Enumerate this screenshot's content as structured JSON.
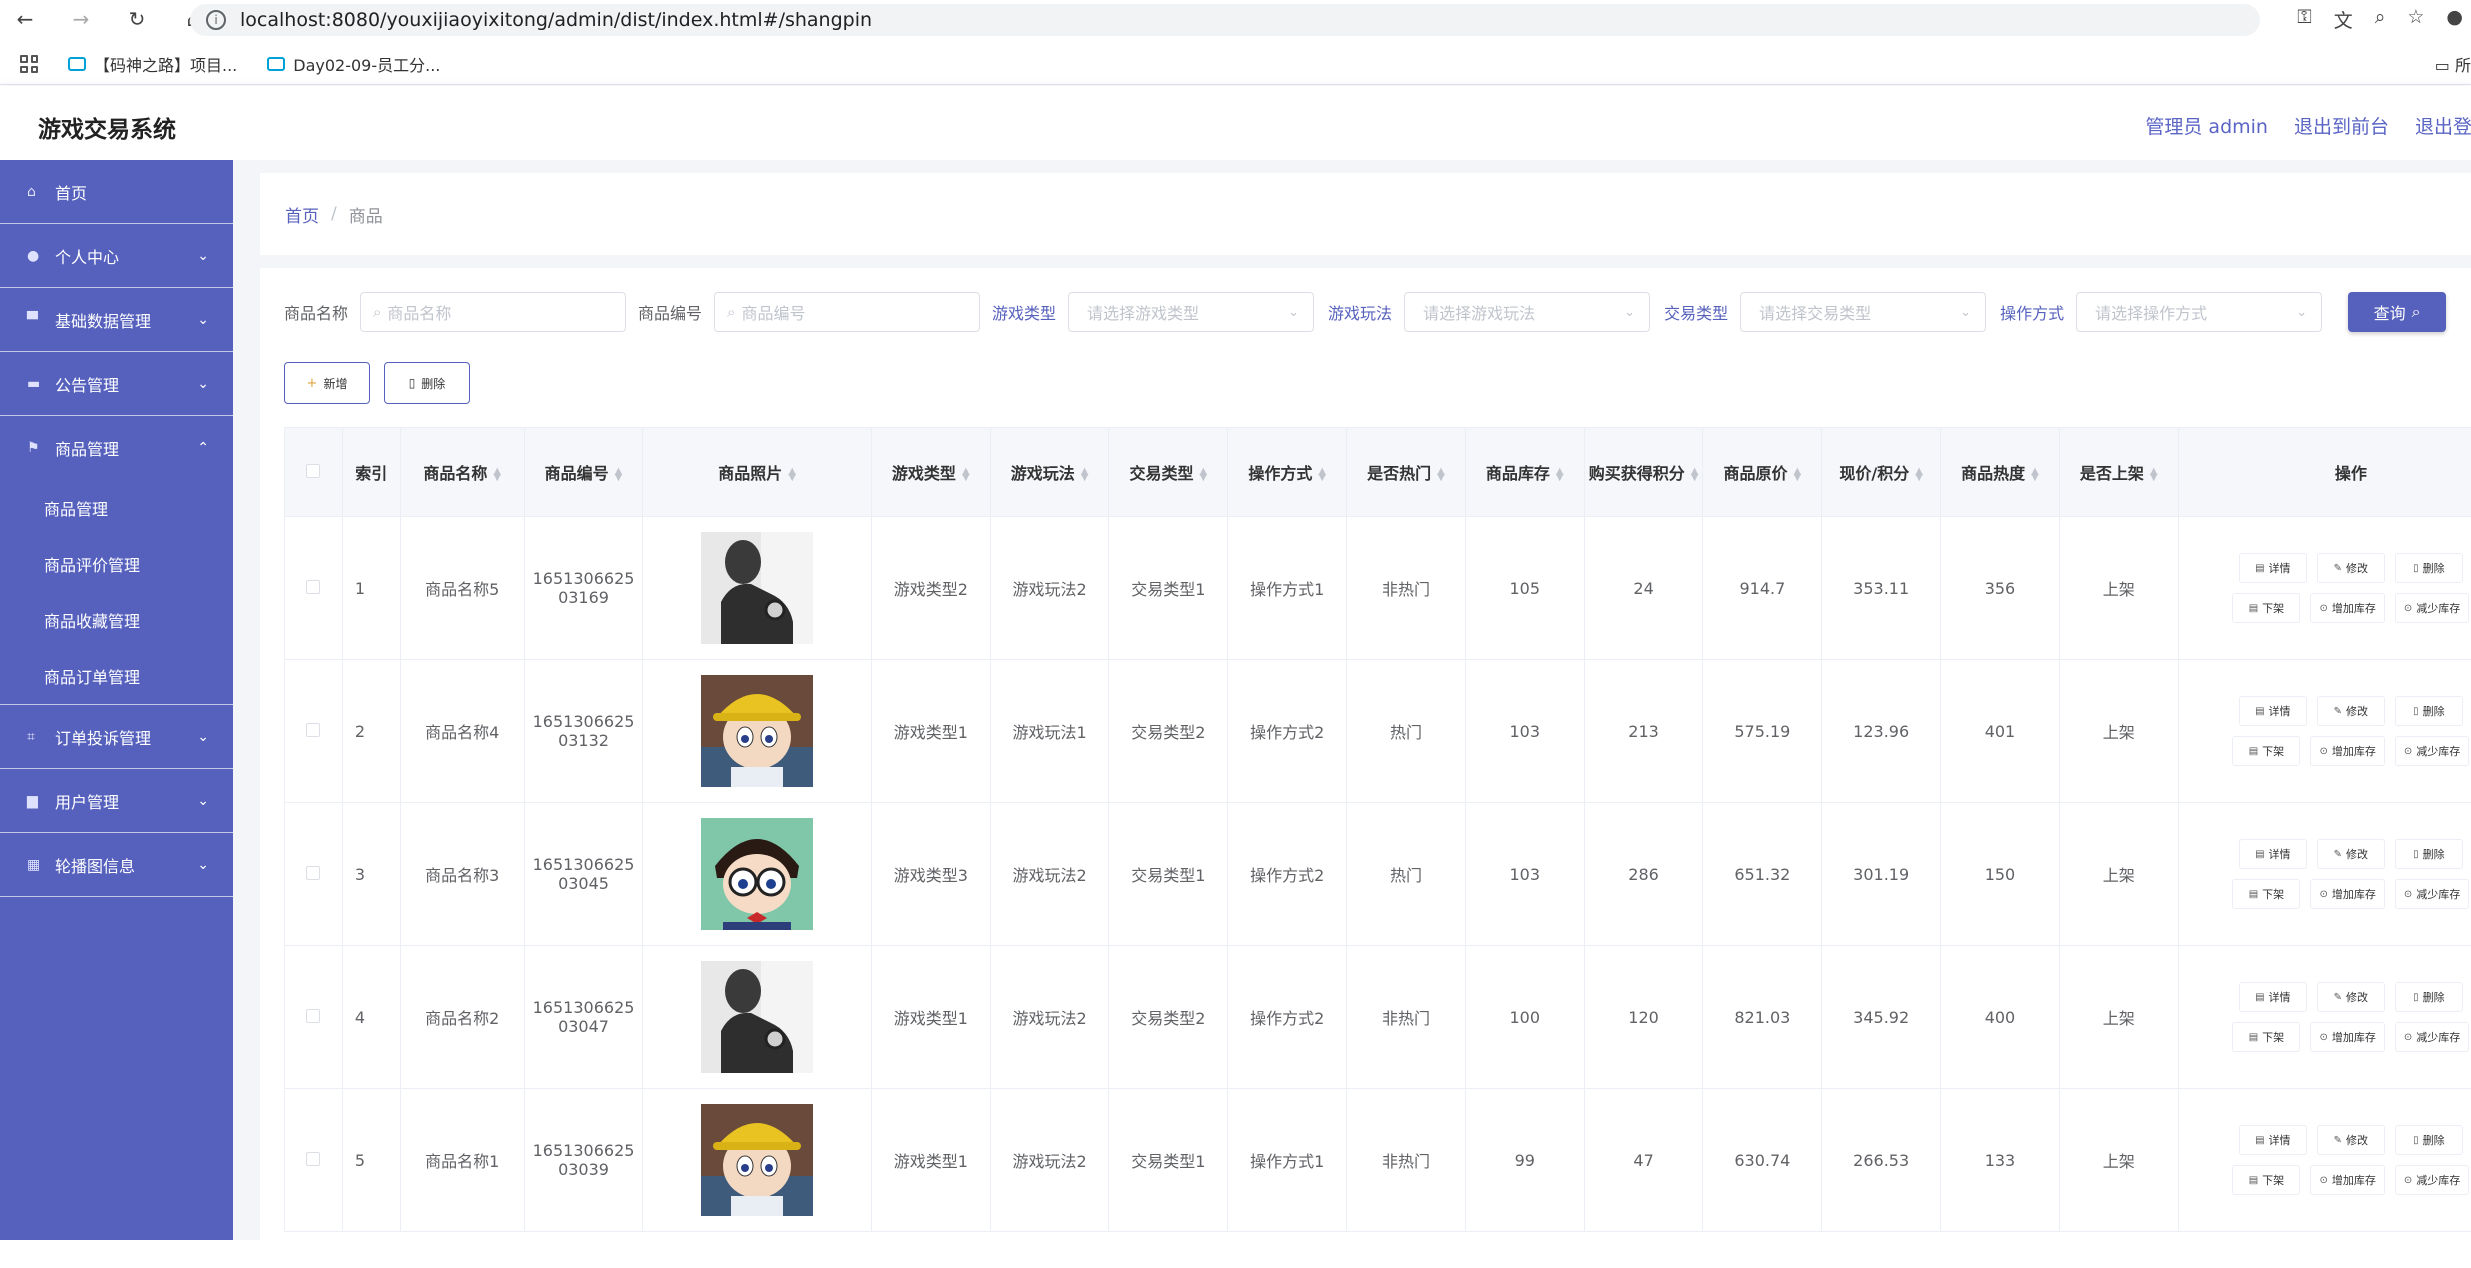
{
  "browser": {
    "url": "localhost:8080/youxijiaoyixitong/admin/dist/index.html#/shangpin",
    "bookmarks": [
      "【码神之路】项目...",
      "Day02-09-员工分..."
    ],
    "folder_label": "所"
  },
  "header": {
    "title": "游戏交易系统",
    "user": "管理员 admin",
    "to_front": "退出到前台",
    "logout": "退出登录"
  },
  "sidebar": {
    "items": [
      {
        "label": "首页",
        "icon": "home-icon"
      },
      {
        "label": "个人中心",
        "icon": "user-icon"
      },
      {
        "label": "基础数据管理",
        "icon": "data-icon"
      },
      {
        "label": "公告管理",
        "icon": "monitor-icon"
      },
      {
        "label": "商品管理",
        "icon": "flag-icon"
      },
      {
        "label": "订单投诉管理",
        "icon": "crop-icon"
      },
      {
        "label": "用户管理",
        "icon": "briefcase-icon"
      },
      {
        "label": "轮播图信息",
        "icon": "film-icon"
      }
    ],
    "sub_items": [
      "商品管理",
      "商品评价管理",
      "商品收藏管理",
      "商品订单管理"
    ]
  },
  "breadcrumb": {
    "home": "首页",
    "sep": "/",
    "current": "商品"
  },
  "search": {
    "name_label": "商品名称",
    "name_placeholder": "商品名称",
    "code_label": "商品编号",
    "code_placeholder": "商品编号",
    "type_label": "游戏类型",
    "type_placeholder": "请选择游戏类型",
    "play_label": "游戏玩法",
    "play_placeholder": "请选择游戏玩法",
    "trade_label": "交易类型",
    "trade_placeholder": "请选择交易类型",
    "op_label": "操作方式",
    "op_placeholder": "请选择操作方式",
    "query": "查询"
  },
  "buttons": {
    "add": "新增",
    "delete": "删除"
  },
  "table": {
    "columns": [
      "索引",
      "商品名称",
      "商品编号",
      "商品照片",
      "游戏类型",
      "游戏玩法",
      "交易类型",
      "操作方式",
      "是否热门",
      "商品库存",
      "购买获得积分",
      "商品原价",
      "现价/积分",
      "商品热度",
      "是否上架",
      "操作"
    ],
    "actions": [
      "详情",
      "修改",
      "删除",
      "下架",
      "增加库存",
      "减少库存"
    ],
    "rows": [
      {
        "index": "1",
        "name": "商品名称5",
        "code1": "1651306625",
        "code2": "03169",
        "photo": "silhouette",
        "type": "游戏类型2",
        "play": "游戏玩法2",
        "trade": "交易类型1",
        "op": "操作方式1",
        "hot": "非热门",
        "stock": "105",
        "points": "24",
        "price": "914.7",
        "now": "353.11",
        "heat": "356",
        "shelf": "上架"
      },
      {
        "index": "2",
        "name": "商品名称4",
        "code1": "1651306625",
        "code2": "03132",
        "photo": "cartoon-hat",
        "type": "游戏类型1",
        "play": "游戏玩法1",
        "trade": "交易类型2",
        "op": "操作方式2",
        "hot": "热门",
        "stock": "103",
        "points": "213",
        "price": "575.19",
        "now": "123.96",
        "heat": "401",
        "shelf": "上架"
      },
      {
        "index": "3",
        "name": "商品名称3",
        "code1": "1651306625",
        "code2": "03045",
        "photo": "cartoon-glasses",
        "type": "游戏类型3",
        "play": "游戏玩法2",
        "trade": "交易类型1",
        "op": "操作方式2",
        "hot": "热门",
        "stock": "103",
        "points": "286",
        "price": "651.32",
        "now": "301.19",
        "heat": "150",
        "shelf": "上架"
      },
      {
        "index": "4",
        "name": "商品名称2",
        "code1": "1651306625",
        "code2": "03047",
        "photo": "silhouette",
        "type": "游戏类型1",
        "play": "游戏玩法2",
        "trade": "交易类型2",
        "op": "操作方式2",
        "hot": "非热门",
        "stock": "100",
        "points": "120",
        "price": "821.03",
        "now": "345.92",
        "heat": "400",
        "shelf": "上架"
      },
      {
        "index": "5",
        "name": "商品名称1",
        "code1": "1651306625",
        "code2": "03039",
        "photo": "cartoon-hat",
        "type": "游戏类型1",
        "play": "游戏玩法2",
        "trade": "交易类型1",
        "op": "操作方式1",
        "hot": "非热门",
        "stock": "99",
        "points": "47",
        "price": "630.74",
        "now": "266.53",
        "heat": "133",
        "shelf": "上架"
      }
    ]
  },
  "colors": {
    "accent": "#5661bd",
    "sidebar": "#5661bd",
    "link": "#5a64c5"
  }
}
